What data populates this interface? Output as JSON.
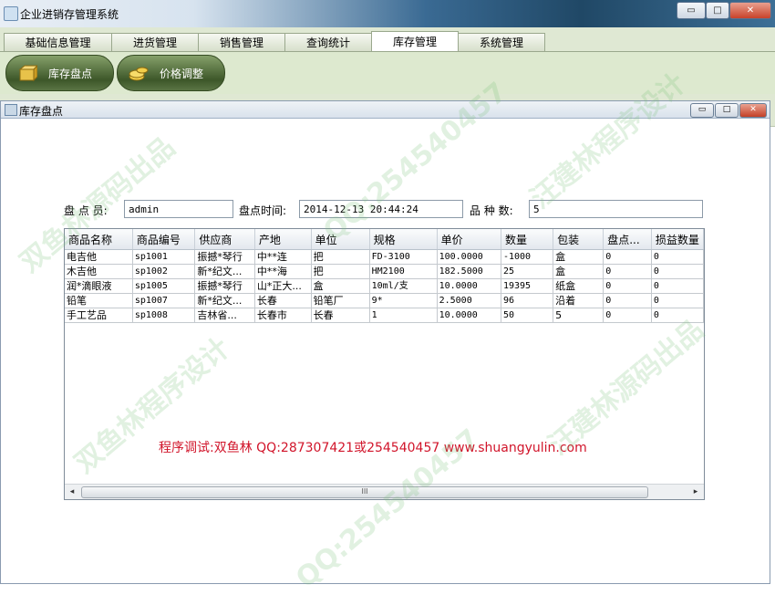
{
  "window": {
    "title": "企业进销存管理系统",
    "min_label": "▭",
    "max_label": "□",
    "close_label": "✕"
  },
  "tabs": [
    {
      "label": "基础信息管理"
    },
    {
      "label": "进货管理"
    },
    {
      "label": "销售管理"
    },
    {
      "label": "查询统计"
    },
    {
      "label": "库存管理",
      "active": true
    },
    {
      "label": "系统管理"
    }
  ],
  "toolbar": {
    "inventory_check_label": "库存盘点",
    "price_adjust_label": "价格调整"
  },
  "internal_frame": {
    "title": "库存盘点"
  },
  "form": {
    "checker_label": "盘 点 员:",
    "checker_value": "admin",
    "time_label": "盘点时间:",
    "time_value": "2014-12-13 20:44:24",
    "count_label": "品 种 数:",
    "count_value": "5"
  },
  "table": {
    "columns": [
      "商品名称",
      "商品编号",
      "供应商",
      "产地",
      "单位",
      "规格",
      "单价",
      "数量",
      "包装",
      "盘点...",
      "损益数量"
    ],
    "rows": [
      [
        "电吉他",
        "sp1001",
        "振撼*琴行",
        "中**连",
        "把",
        "FD-3100",
        "100.0000",
        "-1000",
        "盒",
        "0",
        "0"
      ],
      [
        "木吉他",
        "sp1002",
        "新*纪文...",
        "中**海",
        "把",
        "HM2100",
        "182.5000",
        "25",
        "盒",
        "0",
        "0"
      ],
      [
        "润*滴眼液",
        "sp1005",
        "振撼*琴行",
        "山*正大...",
        "盒",
        "10ml/支",
        "10.0000",
        "19395",
        "纸盒",
        "0",
        "0"
      ],
      [
        "铅笔",
        "sp1007",
        "新*纪文...",
        "长春",
        "铅笔厂",
        "9*",
        "2.5000",
        "96",
        "沿着",
        "0",
        "0"
      ],
      [
        "手工艺品",
        "sp1008",
        "吉林省...",
        "长春市",
        "长春",
        "1",
        "10.0000",
        "50",
        "5",
        "0",
        "0"
      ]
    ]
  },
  "scrollbar": {
    "left_arrow": "◂",
    "right_arrow": "▸",
    "grip": "III"
  },
  "credit": "程序调试:双鱼林 QQ:287307421或254540457 www.shuangyulin.com",
  "watermarks": [
    "双鱼林源码出品",
    "QQ:254540457",
    "汪建林程序设计",
    "双鱼林程序设计",
    "汪建林源码出品",
    "QQ:254540457"
  ],
  "colors": {
    "credit_red": "#d1142a",
    "toolbar_green": "#3d5729",
    "menubar_bg": "#dfe8d3"
  }
}
